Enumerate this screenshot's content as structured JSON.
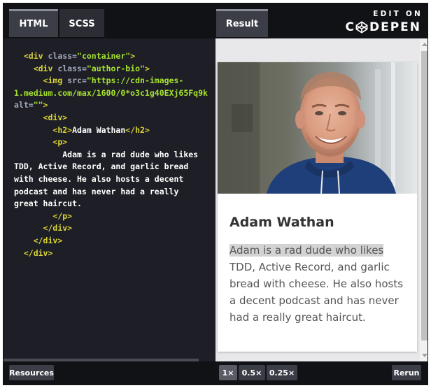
{
  "tabs": [
    {
      "label": "HTML",
      "active": true
    },
    {
      "label": "SCSS",
      "active": false
    }
  ],
  "result_tab": {
    "label": "Result",
    "active": true
  },
  "logo": {
    "line1": "EDIT ON",
    "word_a": "C",
    "word_b": "DEPEN"
  },
  "code_lines": [
    [
      {
        "t": "  "
      },
      {
        "c": "tag",
        "t": "<div "
      },
      {
        "c": "attr",
        "t": "class="
      },
      {
        "c": "val",
        "t": "\"container\""
      },
      {
        "c": "tag",
        "t": ">"
      }
    ],
    [
      {
        "t": "    "
      },
      {
        "c": "tag",
        "t": "<div "
      },
      {
        "c": "attr",
        "t": "class="
      },
      {
        "c": "val",
        "t": "\"author-bio\""
      },
      {
        "c": "tag",
        "t": ">"
      }
    ],
    [
      {
        "t": "      "
      },
      {
        "c": "tag",
        "t": "<img "
      },
      {
        "c": "attr",
        "t": "src="
      },
      {
        "c": "val",
        "t": "\"https://cdn-images-"
      }
    ],
    [
      {
        "c": "val",
        "t": "1.medium.com/max/1600/0*o3c1g40EXj65Fq9k"
      }
    ],
    [
      {
        "c": "attr",
        "t": "alt="
      },
      {
        "c": "val",
        "t": "\"\""
      },
      {
        "c": "tag",
        "t": ">"
      }
    ],
    [
      {
        "t": "      "
      },
      {
        "c": "tag",
        "t": "<div>"
      }
    ],
    [
      {
        "t": "        "
      },
      {
        "c": "tag",
        "t": "<h2>"
      },
      {
        "c": "txt",
        "t": "Adam Wathan"
      },
      {
        "c": "tag",
        "t": "</h2>"
      }
    ],
    [
      {
        "t": "        "
      },
      {
        "c": "tag",
        "t": "<p>"
      }
    ],
    [
      {
        "c": "txt",
        "t": "          Adam is a rad dude who likes"
      }
    ],
    [
      {
        "c": "txt",
        "t": "TDD, Active Record, and garlic bread"
      }
    ],
    [
      {
        "c": "txt",
        "t": "with cheese. He also hosts a decent"
      }
    ],
    [
      {
        "c": "txt",
        "t": "podcast and has never had a really"
      }
    ],
    [
      {
        "c": "txt",
        "t": "great haircut."
      }
    ],
    [
      {
        "t": "        "
      },
      {
        "c": "tag",
        "t": "</p>"
      }
    ],
    [
      {
        "t": "      "
      },
      {
        "c": "tag",
        "t": "</div>"
      }
    ],
    [
      {
        "t": "    "
      },
      {
        "c": "tag",
        "t": "</div>"
      }
    ],
    [
      {
        "t": "  "
      },
      {
        "c": "tag",
        "t": "</div>"
      }
    ]
  ],
  "card": {
    "name": "Adam Wathan",
    "bio_highlighted": "Adam is a rad dude who likes",
    "bio_rest": " TDD, Active Record, and garlic bread with cheese. He also hosts a decent podcast and has never had a really great haircut."
  },
  "footer": {
    "resources": "Resources",
    "zoom_options": [
      "1×",
      "0.5×",
      "0.25×"
    ],
    "zoom_selected": "1×",
    "rerun": "Rerun"
  },
  "icons": {
    "logo": "codepen-cube-icon",
    "scroll_up": "scroll-up-arrow-icon",
    "scroll_down": "scroll-down-arrow-icon"
  },
  "colors": {
    "header_bg": "#111216",
    "code_bg": "#1e1f26",
    "tag": "#d9d336",
    "attr": "#a1a8b8",
    "value": "#a6e22e",
    "text": "#ffffff"
  }
}
